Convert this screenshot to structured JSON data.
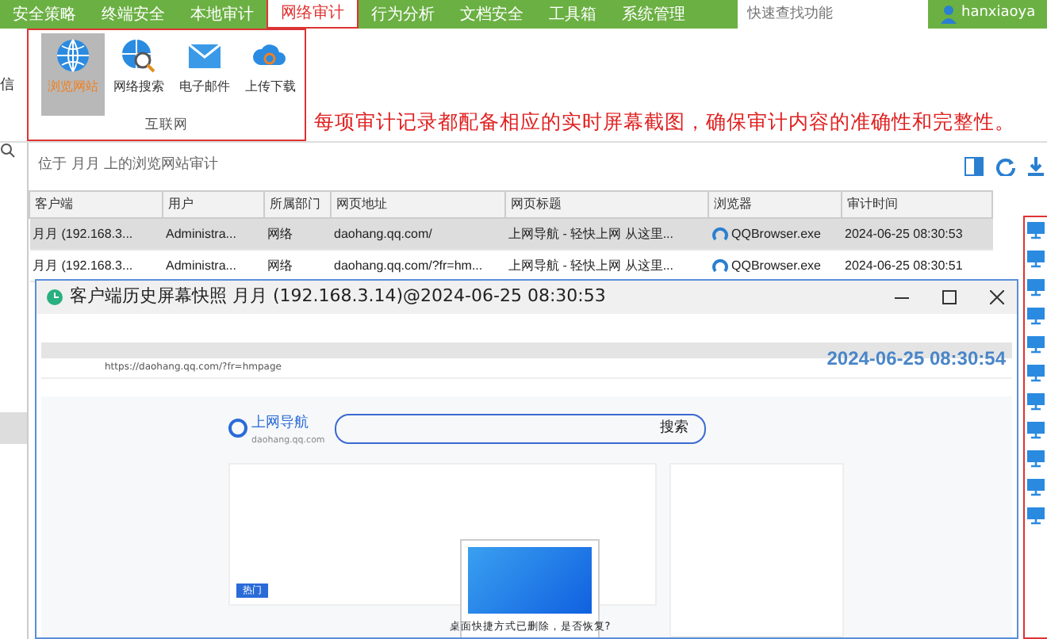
{
  "nav": {
    "tabs": [
      {
        "label": "安全策略",
        "selected": false
      },
      {
        "label": "终端安全",
        "selected": false
      },
      {
        "label": "本地审计",
        "selected": false
      },
      {
        "label": "网络审计",
        "selected": true
      },
      {
        "label": "行为分析",
        "selected": false
      },
      {
        "label": "文档安全",
        "selected": false
      },
      {
        "label": "工具箱",
        "selected": false
      },
      {
        "label": "系统管理",
        "selected": false
      }
    ],
    "search": {
      "placeholder": "快速查找功能"
    },
    "user": "hanxiaoya"
  },
  "ribbon": {
    "left_cut": "信",
    "group": {
      "label": "互联网",
      "items": [
        {
          "label": "浏览网站",
          "kind": "globe",
          "selected": true
        },
        {
          "label": "网络搜索",
          "kind": "search",
          "selected": false
        },
        {
          "label": "电子邮件",
          "kind": "mail",
          "selected": false
        },
        {
          "label": "上传下载",
          "kind": "cloud",
          "selected": false
        }
      ]
    }
  },
  "annotation": "每项审计记录都配备相应的实时屏幕截图，确保审计内容的准确性和完整性。",
  "breadcrumb": "位于 月月 上的浏览网站审计",
  "table": {
    "columns": [
      "客户端",
      "用户",
      "所属部门",
      "网页地址",
      "网页标题",
      "浏览器",
      "审计时间"
    ],
    "rows": [
      {
        "selected": true,
        "cells": [
          "月月 (192.168.3...",
          "Administra...",
          "网络",
          "daohang.qq.com/",
          "上网导航 - 轻快上网 从这里...",
          "QQBrowser.exe",
          "2024-06-25 08:30:53"
        ]
      },
      {
        "selected": false,
        "cells": [
          "月月 (192.168.3...",
          "Administra...",
          "网络",
          "daohang.qq.com/?fr=hm...",
          "上网导航 - 轻快上网 从这里...",
          "QQBrowser.exe",
          "2024-06-25 08:30:51"
        ]
      }
    ]
  },
  "snapshot_window": {
    "title": "客户端历史屏幕快照 月月 (192.168.3.14)@2024-06-25 08:30:53",
    "browser": {
      "url": "https://daohang.qq.com/?fr=hmpage",
      "timestamp": "2024-06-25 08:30:54",
      "logo": "上网导航",
      "domain": "daohang.qq.com",
      "search_button": "搜索",
      "tab": "热门",
      "popup": "桌面快捷方式已删除，是否恢复?"
    }
  }
}
